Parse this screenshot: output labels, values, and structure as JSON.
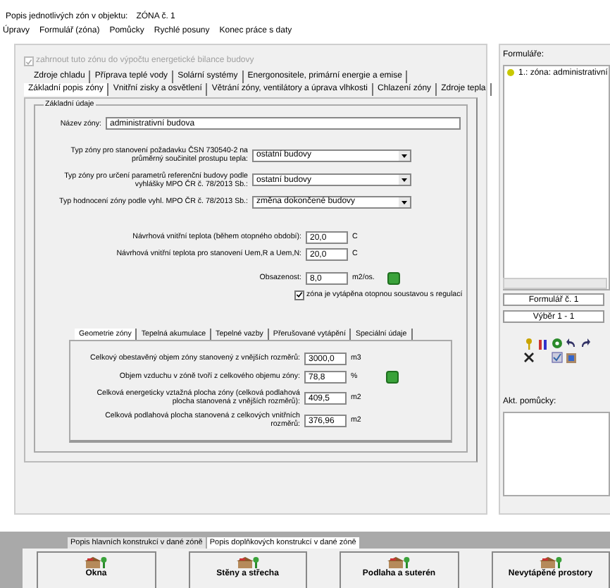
{
  "window": {
    "title": "Popis jednotlivých zón v objektu:",
    "zone": "ZÓNA č. 1"
  },
  "menu": [
    "Úpravy",
    "Formulář (zóna)",
    "Pomůcky",
    "Rychlé posuny",
    "Konec práce s daty"
  ],
  "include_checkbox": {
    "label": "zahrnout tuto zónu do výpočtu energetické bilance budovy",
    "checked": true,
    "disabled": true
  },
  "tabs_row1": [
    {
      "label": "Zdroje chladu",
      "selected": false
    },
    {
      "label": "Příprava teplé vody",
      "selected": false
    },
    {
      "label": "Solární systémy",
      "selected": false
    },
    {
      "label": "Energonositele, primární energie a emise",
      "selected": false
    }
  ],
  "tabs_row2": [
    {
      "label": "Základní popis zóny",
      "selected": true
    },
    {
      "label": "Vnitřní zisky a osvětlení",
      "selected": false
    },
    {
      "label": "Větrání zóny, ventilátory a úprava vlhkosti",
      "selected": false
    },
    {
      "label": "Chlazení zóny",
      "selected": false
    },
    {
      "label": "Zdroje tepla",
      "selected": false
    }
  ],
  "group": {
    "title": "Základní údaje"
  },
  "fields": [
    {
      "kind": "text",
      "label": "Název zóny:",
      "value": "administrativní budova"
    },
    {
      "kind": "select",
      "label": "Typ zóny pro stanovení požadavku ČSN 730540-2 na průměrný součinitel prostupu tepla:",
      "value": "ostatní budovy"
    },
    {
      "kind": "select",
      "label": "Typ zóny pro určení parametrů referenční budovy podle vyhlášky MPO ČR č. 78/2013 Sb.:",
      "value": "ostatní budovy"
    },
    {
      "kind": "select",
      "label": "Typ hodnocení zóny podle vyhl. MPO ČR č. 78/2013 Sb.:",
      "value": "změna dokončené budovy"
    },
    {
      "kind": "number",
      "label": "Návrhová vnitřní teplota (během otopného období):",
      "value": "20,0",
      "unit": "C"
    },
    {
      "kind": "number",
      "label": "Návrhová vnitřní teplota pro stanovení Uem,R a Uem,N:",
      "value": "20,0",
      "unit": "C"
    },
    {
      "kind": "number",
      "label": "Obsazenost:",
      "value": "8,0",
      "unit": "m2/os.",
      "button": true
    }
  ],
  "heated_checkbox": {
    "label": "zóna je vytápěna otopnou soustavou s regulací",
    "checked": true
  },
  "sub_tabs": [
    {
      "label": "Geometrie zóny",
      "selected": true
    },
    {
      "label": "Tepelná akumulace",
      "selected": false
    },
    {
      "label": "Tepelné vazby",
      "selected": false
    },
    {
      "label": "Přerušované vytápění",
      "selected": false
    },
    {
      "label": "Speciální údaje",
      "selected": false
    }
  ],
  "sub_fields": [
    {
      "label": "Celkový obestavěný objem zóny stanovený z vnějších rozměrů:",
      "value": "3000,0",
      "unit": "m3"
    },
    {
      "label": "Objem vzduchu v zóně tvoří z celkového objemu zóny:",
      "value": "78,8",
      "unit": "%",
      "button": true
    },
    {
      "label": "Celková energeticky vztažná plocha zóny (celková podlahová plocha stanovená z vnějších rozměrů):",
      "value": "409,5",
      "unit": "m2"
    },
    {
      "label": "Celková podlahová plocha stanovená z celkových vnitřních rozměrů:",
      "value": "376,96",
      "unit": "m2"
    }
  ],
  "sidebar": {
    "forms_label": "Formuláře:",
    "items": [
      {
        "label": "1.: zóna: administrativní",
        "color": "#c8c800"
      }
    ],
    "form_number": "Formulář č. 1",
    "selection": "Výběr 1 - 1",
    "aids_label": "Akt. pomůcky:"
  },
  "bottom_tabs": [
    {
      "label": "Popis hlavních konstrukcí v dané zóně",
      "selected": false
    },
    {
      "label": "Popis doplňkových konstrukcí v dané zóně",
      "selected": true
    }
  ],
  "bottom_buttons": [
    "Okna",
    "Stěny a střecha",
    "Podlaha a suterén",
    "Nevytápěné prostory"
  ]
}
